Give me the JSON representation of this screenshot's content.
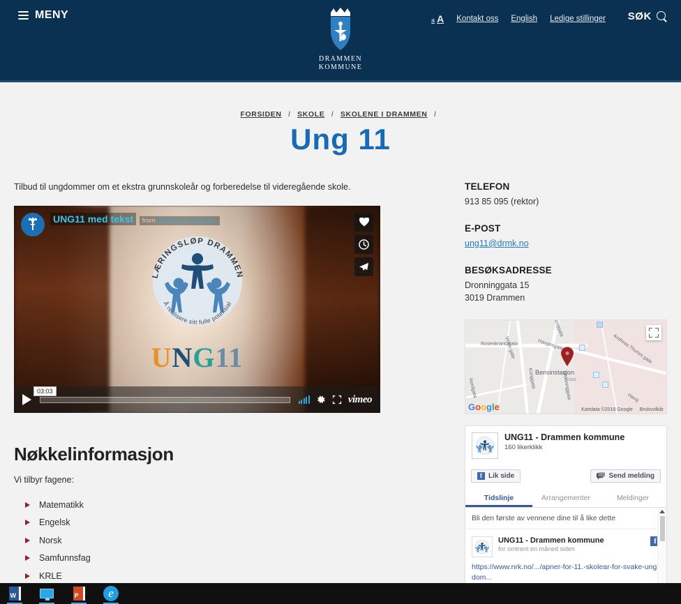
{
  "header": {
    "menu_label": "MENY",
    "menu_icon": "hamburger-icon",
    "logo_line1": "DRAMMEN",
    "logo_line2": "KOMMUNE",
    "logo_icon": "drammen-coat-of-arms",
    "textsize_small": "a",
    "textsize_large": "A",
    "links": [
      {
        "label": "Kontakt oss"
      },
      {
        "label": "English"
      },
      {
        "label": "Ledige stillinger"
      }
    ],
    "search_label": "SØK",
    "search_icon": "magnifier-icon",
    "nav_bg": "#0a3052"
  },
  "breadcrumb": {
    "items": [
      "FORSIDEN",
      "SKOLE",
      "SKOLENE I DRAMMEN"
    ],
    "separator": "/"
  },
  "title": "Ung 11",
  "title_color": "#176bb5",
  "main": {
    "intro": "Tilbud til ungdommer om et ekstra grunnskoleår og forberedelse til videregående skole.",
    "video": {
      "title": "UNG11 med tekst",
      "from_prefix": "from",
      "author": "Drammen kommune",
      "duration": "03:03",
      "provider": "vimeo",
      "play_icon": "play-icon",
      "like_icon": "heart-icon",
      "watchlater_icon": "clock-icon",
      "share_icon": "paper-plane-icon",
      "quality_icon": "signal-bars-icon",
      "settings_icon": "gear-icon",
      "fullscreen_icon": "fullscreen-icon",
      "badge_top_text": "LÆRINGSLØP DRAMMEN",
      "badge_bottom_text": "Å realisere sitt fulle potensial",
      "wordmark": {
        "u": "U",
        "n": "N",
        "g": "G",
        "one": "11"
      }
    },
    "section_heading": "Nøkkelinformasjon",
    "subjects_lead": "Vi tilbyr fagene:",
    "subjects": [
      "Matematikk",
      "Engelsk",
      "Norsk",
      "Samfunnsfag",
      "KRLE"
    ],
    "bullet_color": "#8b2231"
  },
  "sidebar": {
    "phone_heading": "TELEFON",
    "phone_value": "913 85 095 (rektor)",
    "email_heading": "E-POST",
    "email_value": "ung11@drmk.no",
    "address_heading": "BESØKSADRESSE",
    "address_line1": "Dronninggata 15",
    "address_line2": "3019 Drammen",
    "map": {
      "labels": [
        "Rosenkrantzgata",
        "Konggata",
        "Haugesgate",
        "Andreas Thunes gate",
        "Veien gate",
        "Nordgata",
        "Konggata",
        "Dronninggata",
        "Haug",
        "Bensinstasjon",
        "Esso"
      ],
      "credit": "Kartdata ©2018 Google",
      "terms": "Bruksvilkår",
      "logo": "Google",
      "expand_icon": "fullscreen-icon",
      "pin_icon": "map-pin-icon"
    },
    "facebook": {
      "page_name": "UNG11 - Drammen kommune",
      "likes": "160 likerklikk",
      "like_button": "Lik side",
      "message_button": "Send melding",
      "like_icon": "facebook-f-icon",
      "message_icon": "messenger-icon",
      "tabs": [
        {
          "label": "Tidslinje",
          "active": true
        },
        {
          "label": "Arrangementer",
          "active": false
        },
        {
          "label": "Meldinger",
          "active": false
        }
      ],
      "note": "Bli den første av vennene dine til å like dette",
      "post": {
        "author": "UNG11 - Drammen kommune",
        "time": "for omtrent en måned siden",
        "link": "https://www.nrk.no/.../apner-for-11.-skolear-for-svake-ungdom...",
        "brand_icon": "facebook-f-icon"
      },
      "scroll_icon": "scroll-up-arrow"
    }
  },
  "taskbar": {
    "items": [
      {
        "name": "word-icon",
        "label": "W"
      },
      {
        "name": "display-icon",
        "label": ""
      },
      {
        "name": "powerpoint-icon",
        "label": "P"
      },
      {
        "name": "edge-icon",
        "label": "e"
      }
    ]
  }
}
